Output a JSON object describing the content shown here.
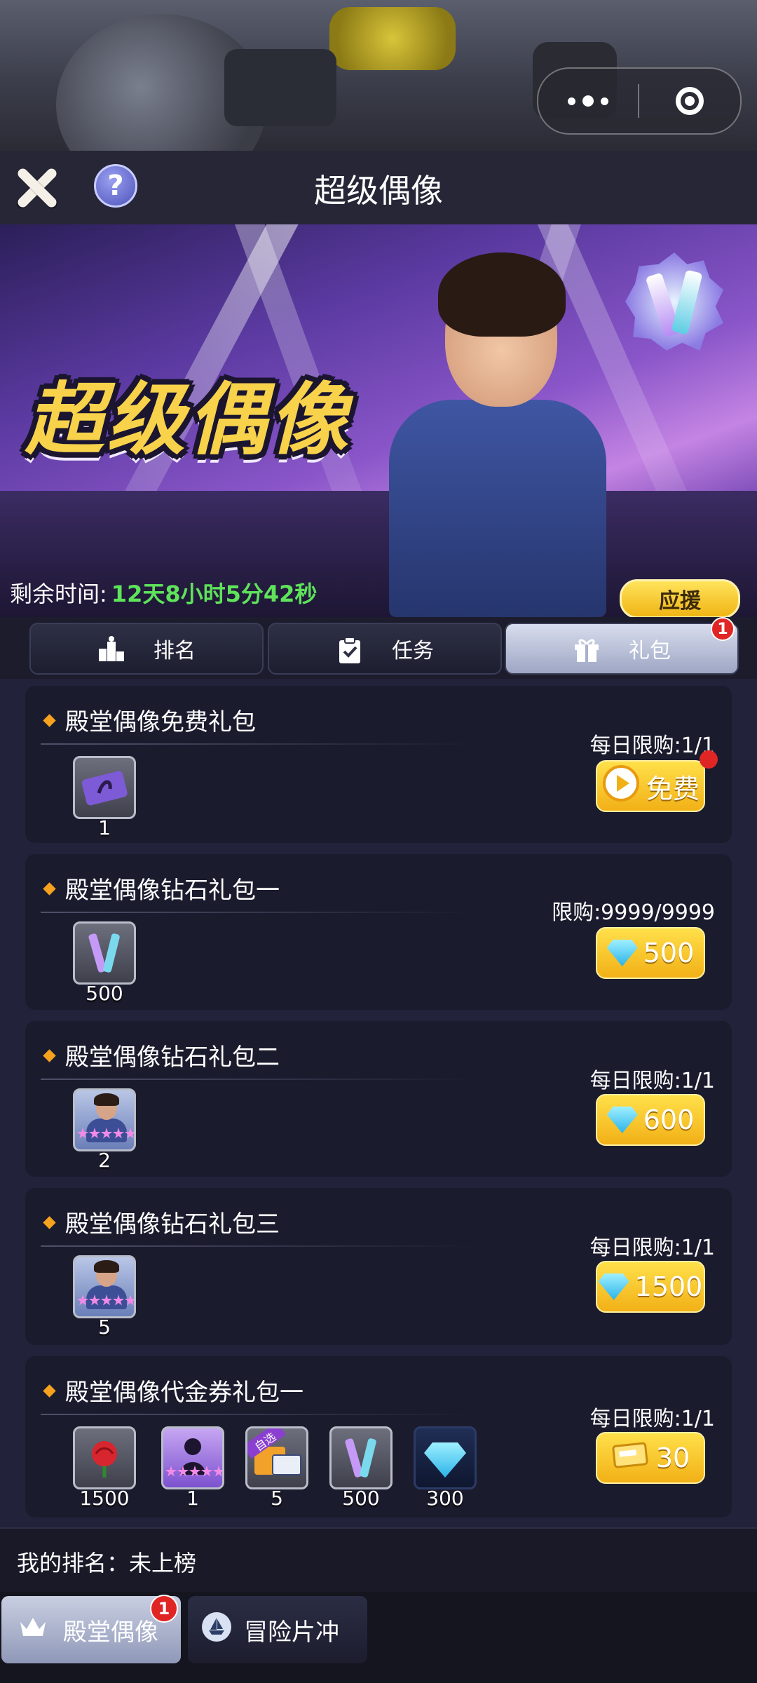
{
  "capsule": {
    "more_icon": "more-dots-icon",
    "close_icon": "target-circle-icon"
  },
  "header": {
    "title": "超级偶像"
  },
  "banner": {
    "logo_text": "超级偶像",
    "time_label": "剩余时间:",
    "time_value": "12天8小时5分42秒",
    "cheer_label": "应援"
  },
  "tabs": [
    {
      "label": "排名",
      "icon": "podium-icon"
    },
    {
      "label": "任务",
      "icon": "clipboard-check-icon"
    },
    {
      "label": "礼包",
      "icon": "gift-icon",
      "badge": "1",
      "active": true
    }
  ],
  "packs": [
    {
      "title": "殿堂偶像免费礼包",
      "limit": "每日限购:1/1",
      "price": "免费",
      "price_icon": "play-circle-icon",
      "items": [
        {
          "qty": "1",
          "icon": "purple-ticket-icon"
        }
      ]
    },
    {
      "title": "殿堂偶像钻石礼包一",
      "limit": "限购:9999/9999",
      "price": "500",
      "price_icon": "diamond-icon",
      "items": [
        {
          "qty": "500",
          "icon": "lightstick-icon"
        }
      ]
    },
    {
      "title": "殿堂偶像钻石礼包二",
      "limit": "每日限购:1/1",
      "price": "600",
      "price_icon": "diamond-icon",
      "items": [
        {
          "qty": "2",
          "icon": "idol-card-icon"
        }
      ]
    },
    {
      "title": "殿堂偶像钻石礼包三",
      "limit": "每日限购:1/1",
      "price": "1500",
      "price_icon": "diamond-icon",
      "items": [
        {
          "qty": "5",
          "icon": "idol-card-icon"
        }
      ]
    },
    {
      "title": "殿堂偶像代金券礼包一",
      "limit": "每日限购:1/1",
      "price": "30",
      "price_icon": "voucher-icon",
      "items": [
        {
          "qty": "1500",
          "icon": "rose-icon"
        },
        {
          "qty": "1",
          "icon": "silhouette-card-icon"
        },
        {
          "qty": "5",
          "icon": "selectable-box-icon",
          "tag": "自选"
        },
        {
          "qty": "500",
          "icon": "lightstick-icon"
        },
        {
          "qty": "300",
          "icon": "diamond-icon"
        }
      ]
    }
  ],
  "my_rank": {
    "text": "我的排名：未上榜"
  },
  "bottom_nav": [
    {
      "label": "殿堂偶像",
      "icon": "crown-icon",
      "badge": "1",
      "active": true
    },
    {
      "label": "冒险片冲",
      "icon": "ship-icon",
      "active": false
    }
  ],
  "colors": {
    "accent_gold": "#f2b017",
    "time_green": "#5ee35a",
    "badge_red": "#e02525",
    "panel_bg": "#1b1b2e"
  }
}
